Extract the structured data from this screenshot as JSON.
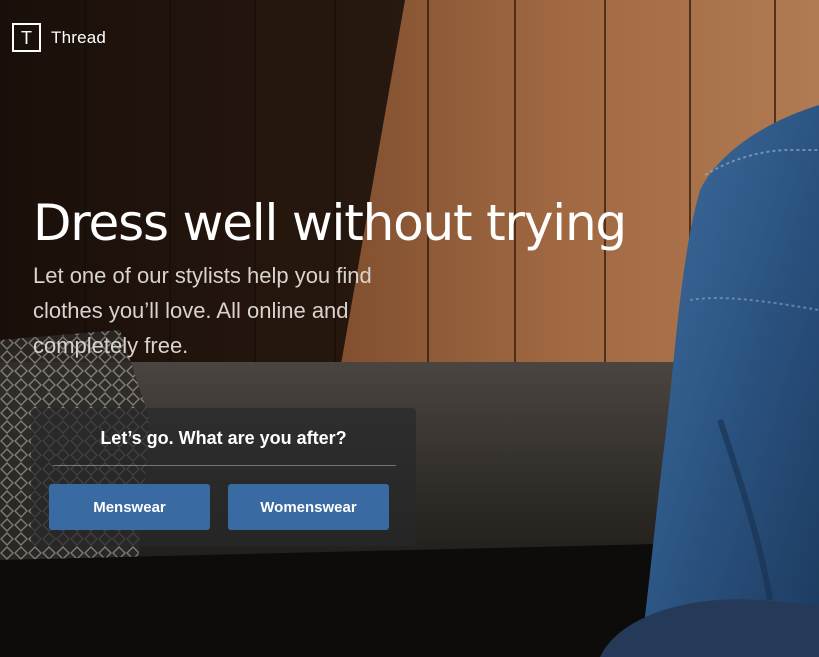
{
  "brand": {
    "logo_letter": "T",
    "name": "Thread"
  },
  "hero": {
    "headline": "Dress well without trying",
    "subline": "Let one of our stylists help you find clothes you’ll love. All online and completely free."
  },
  "cta": {
    "prompt": "Let’s go. What are you after?",
    "menswear_label": "Menswear",
    "womenswear_label": "Womenswear"
  },
  "colors": {
    "button": "#3a6aa2",
    "text": "#ffffff",
    "subtext": "#d8d3cc"
  }
}
